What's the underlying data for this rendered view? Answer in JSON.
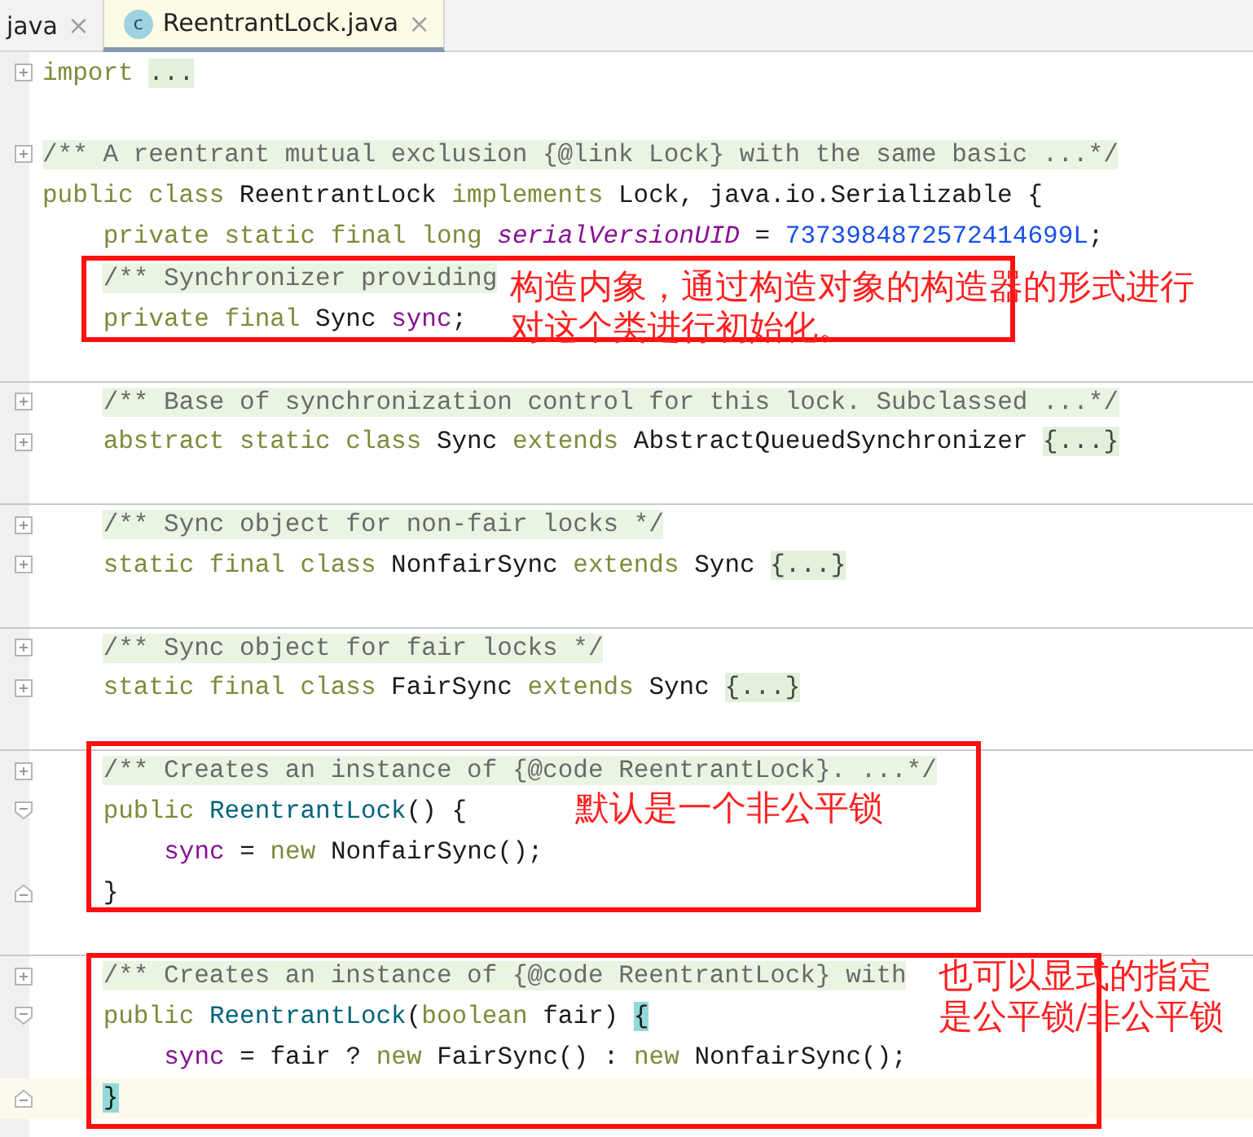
{
  "tabs": [
    {
      "label": "java",
      "selected": false,
      "close": "×"
    },
    {
      "label": "ReentrantLock.java",
      "selected": true,
      "close": "×",
      "icon_text": "c"
    }
  ],
  "lines": [
    {
      "kind": "folded",
      "tokens": [
        {
          "text": "import ",
          "kind": "keyword"
        },
        {
          "text": "...",
          "kind": "fold"
        }
      ]
    },
    {
      "kind": "blank"
    },
    {
      "kind": "folded",
      "tokens": [
        {
          "text": "/** A reentrant mutual exclusion {@link Lock} with the same basic ...*/",
          "kind": "doc"
        }
      ]
    },
    {
      "kind": "code",
      "tokens": [
        {
          "text": "public class ",
          "kind": "keyword"
        },
        {
          "text": "ReentrantLock ",
          "kind": "plain"
        },
        {
          "text": "implements ",
          "kind": "keyword"
        },
        {
          "text": "Lock, java.io.Serializable {",
          "kind": "plain"
        }
      ],
      "children": [
        {
          "kind": "code",
          "tokens": [
            {
              "text": "private static final long ",
              "kind": "keyword"
            },
            {
              "text": "serialVersionUID",
              "kind": "static-field"
            },
            {
              "text": " = ",
              "kind": "plain"
            },
            {
              "text": "7373984872572414699L",
              "kind": "number"
            },
            {
              "text": ";",
              "kind": "plain"
            }
          ]
        },
        {
          "kind": "code",
          "tokens": [
            {
              "text": "/** Synchronizer providing",
              "kind": "doc"
            }
          ]
        },
        {
          "kind": "code",
          "tokens": [
            {
              "text": "private final ",
              "kind": "keyword"
            },
            {
              "text": "Sync ",
              "kind": "plain"
            },
            {
              "text": "sync",
              "kind": "field"
            },
            {
              "text": ";",
              "kind": "plain"
            }
          ]
        },
        {
          "kind": "blank"
        },
        {
          "kind": "folded",
          "separator": true,
          "tokens": [
            {
              "text": "/** Base of synchronization control for this lock. Subclassed ...*/",
              "kind": "doc"
            }
          ]
        },
        {
          "kind": "folded",
          "tokens": [
            {
              "text": "abstract static class ",
              "kind": "keyword"
            },
            {
              "text": "Sync ",
              "kind": "plain"
            },
            {
              "text": "extends ",
              "kind": "keyword"
            },
            {
              "text": "AbstractQueuedSynchronizer ",
              "kind": "plain"
            },
            {
              "text": "{...}",
              "kind": "fold"
            }
          ]
        },
        {
          "kind": "blank"
        },
        {
          "kind": "folded",
          "separator": true,
          "tokens": [
            {
              "text": "/** Sync object for non-fair locks */",
              "kind": "doc"
            }
          ]
        },
        {
          "kind": "folded",
          "tokens": [
            {
              "text": "static final class ",
              "kind": "keyword"
            },
            {
              "text": "NonfairSync ",
              "kind": "plain"
            },
            {
              "text": "extends ",
              "kind": "keyword"
            },
            {
              "text": "Sync ",
              "kind": "plain"
            },
            {
              "text": "{...}",
              "kind": "fold"
            }
          ]
        },
        {
          "kind": "blank"
        },
        {
          "kind": "folded",
          "separator": true,
          "tokens": [
            {
              "text": "/** Sync object for fair locks */",
              "kind": "doc"
            }
          ]
        },
        {
          "kind": "folded",
          "tokens": [
            {
              "text": "static final class ",
              "kind": "keyword"
            },
            {
              "text": "FairSync ",
              "kind": "plain"
            },
            {
              "text": "extends ",
              "kind": "keyword"
            },
            {
              "text": "Sync ",
              "kind": "plain"
            },
            {
              "text": "{...}",
              "kind": "fold"
            }
          ]
        },
        {
          "kind": "blank"
        },
        {
          "kind": "folded",
          "separator": true,
          "tokens": [
            {
              "text": "/** Creates an instance of {@code ReentrantLock}. ...*/",
              "kind": "doc"
            }
          ]
        },
        {
          "kind": "block-start",
          "tokens": [
            {
              "text": "public ",
              "kind": "keyword"
            },
            {
              "text": "ReentrantLock",
              "kind": "method"
            },
            {
              "text": "() {",
              "kind": "plain"
            }
          ],
          "children": [
            {
              "kind": "code",
              "tokens": [
                {
                  "text": "sync",
                  "kind": "field"
                },
                {
                  "text": " = ",
                  "kind": "plain"
                },
                {
                  "text": "new ",
                  "kind": "keyword"
                },
                {
                  "text": "NonfairSync();",
                  "kind": "plain"
                }
              ]
            }
          ]
        },
        {
          "kind": "block-end",
          "tokens": [
            {
              "text": "}",
              "kind": "plain"
            }
          ]
        },
        {
          "kind": "blank"
        },
        {
          "kind": "folded",
          "separator": true,
          "tokens": [
            {
              "text": "/** Creates an instance of {@code ReentrantLock} with",
              "kind": "doc"
            }
          ]
        },
        {
          "kind": "block-start",
          "tokens": [
            {
              "text": "public ",
              "kind": "keyword"
            },
            {
              "text": "ReentrantLock",
              "kind": "method"
            },
            {
              "text": "(",
              "kind": "plain"
            },
            {
              "text": "boolean ",
              "kind": "keyword"
            },
            {
              "text": "fair) ",
              "kind": "plain"
            },
            {
              "text": "{",
              "kind": "brace-match"
            }
          ],
          "children": [
            {
              "kind": "code",
              "tokens": [
                {
                  "text": "sync",
                  "kind": "field"
                },
                {
                  "text": " = fair ? ",
                  "kind": "plain"
                },
                {
                  "text": "new ",
                  "kind": "keyword"
                },
                {
                  "text": "FairSync() : ",
                  "kind": "plain"
                },
                {
                  "text": "new ",
                  "kind": "keyword"
                },
                {
                  "text": "NonfairSync();",
                  "kind": "plain"
                }
              ]
            }
          ]
        },
        {
          "kind": "block-end",
          "current": true,
          "tokens": [
            {
              "text": "}",
              "kind": "brace-match"
            }
          ]
        }
      ]
    }
  ],
  "annotations": [
    {
      "lines": [
        "构造内象，通过构造对象的构造器的形式进行",
        "对这个类进行初始化。"
      ]
    },
    {
      "lines": [
        "默认是一个非公平锁"
      ]
    },
    {
      "lines": [
        "也可以显式的指定",
        "是公平锁/非公平锁"
      ]
    }
  ]
}
